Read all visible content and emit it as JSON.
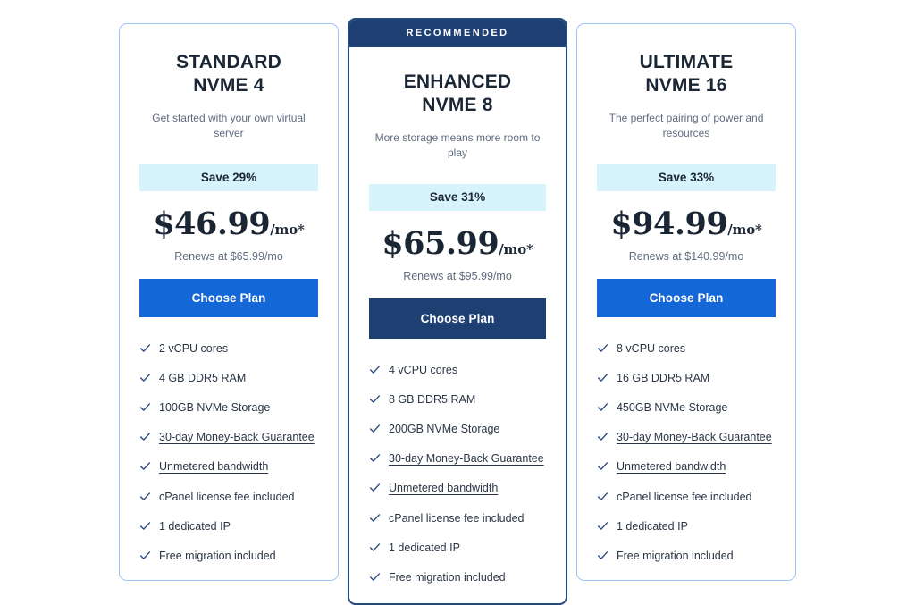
{
  "page": {
    "background": "#ffffff",
    "accent_blue": "#1467d6",
    "accent_navy": "#1e3f72",
    "badge_bg": "#d7f3fb",
    "card_border": "#9fc4f2",
    "featured_border": "#26497d"
  },
  "cards": [
    {
      "id": "standard",
      "ribbon": "",
      "title_line1": "STANDARD",
      "title_line2": "NVME 4",
      "subtitle": "Get started with your own virtual server",
      "save_badge": "Save 29%",
      "price": "$46.99",
      "price_suffix": "/mo*",
      "renews": "Renews at $65.99/mo",
      "cta_label": "Choose Plan",
      "features": [
        {
          "text": "2 vCPU cores",
          "link": false
        },
        {
          "text": "4 GB DDR5 RAM",
          "link": false
        },
        {
          "text": "100GB NVMe Storage",
          "link": false
        },
        {
          "text": "30-day Money-Back Guarantee",
          "link": true
        },
        {
          "text": "Unmetered bandwidth",
          "link": true
        },
        {
          "text": "cPanel license fee included",
          "link": false
        },
        {
          "text": "1 dedicated IP",
          "link": false
        },
        {
          "text": "Free migration included",
          "link": false
        }
      ]
    },
    {
      "id": "enhanced",
      "ribbon": "RECOMMENDED",
      "title_line1": "ENHANCED",
      "title_line2": "NVME 8",
      "subtitle": "More storage means more room to play",
      "save_badge": "Save 31%",
      "price": "$65.99",
      "price_suffix": "/mo*",
      "renews": "Renews at $95.99/mo",
      "cta_label": "Choose Plan",
      "features": [
        {
          "text": "4 vCPU cores",
          "link": false
        },
        {
          "text": "8 GB DDR5 RAM",
          "link": false
        },
        {
          "text": "200GB NVMe Storage",
          "link": false
        },
        {
          "text": "30-day Money-Back Guarantee",
          "link": true
        },
        {
          "text": "Unmetered bandwidth",
          "link": true
        },
        {
          "text": "cPanel license fee included",
          "link": false
        },
        {
          "text": "1 dedicated IP",
          "link": false
        },
        {
          "text": "Free migration included",
          "link": false
        }
      ]
    },
    {
      "id": "ultimate",
      "ribbon": "",
      "title_line1": "ULTIMATE",
      "title_line2": "NVME 16",
      "subtitle": "The perfect pairing of power and resources",
      "save_badge": "Save 33%",
      "price": "$94.99",
      "price_suffix": "/mo*",
      "renews": "Renews at $140.99/mo",
      "cta_label": "Choose Plan",
      "features": [
        {
          "text": "8 vCPU cores",
          "link": false
        },
        {
          "text": "16 GB DDR5 RAM",
          "link": false
        },
        {
          "text": "450GB NVMe Storage",
          "link": false
        },
        {
          "text": "30-day Money-Back Guarantee",
          "link": true
        },
        {
          "text": "Unmetered bandwidth",
          "link": true
        },
        {
          "text": "cPanel license fee included",
          "link": false
        },
        {
          "text": "1 dedicated IP",
          "link": false
        },
        {
          "text": "Free migration included",
          "link": false
        }
      ]
    }
  ],
  "icons": {
    "check": "check-icon"
  }
}
